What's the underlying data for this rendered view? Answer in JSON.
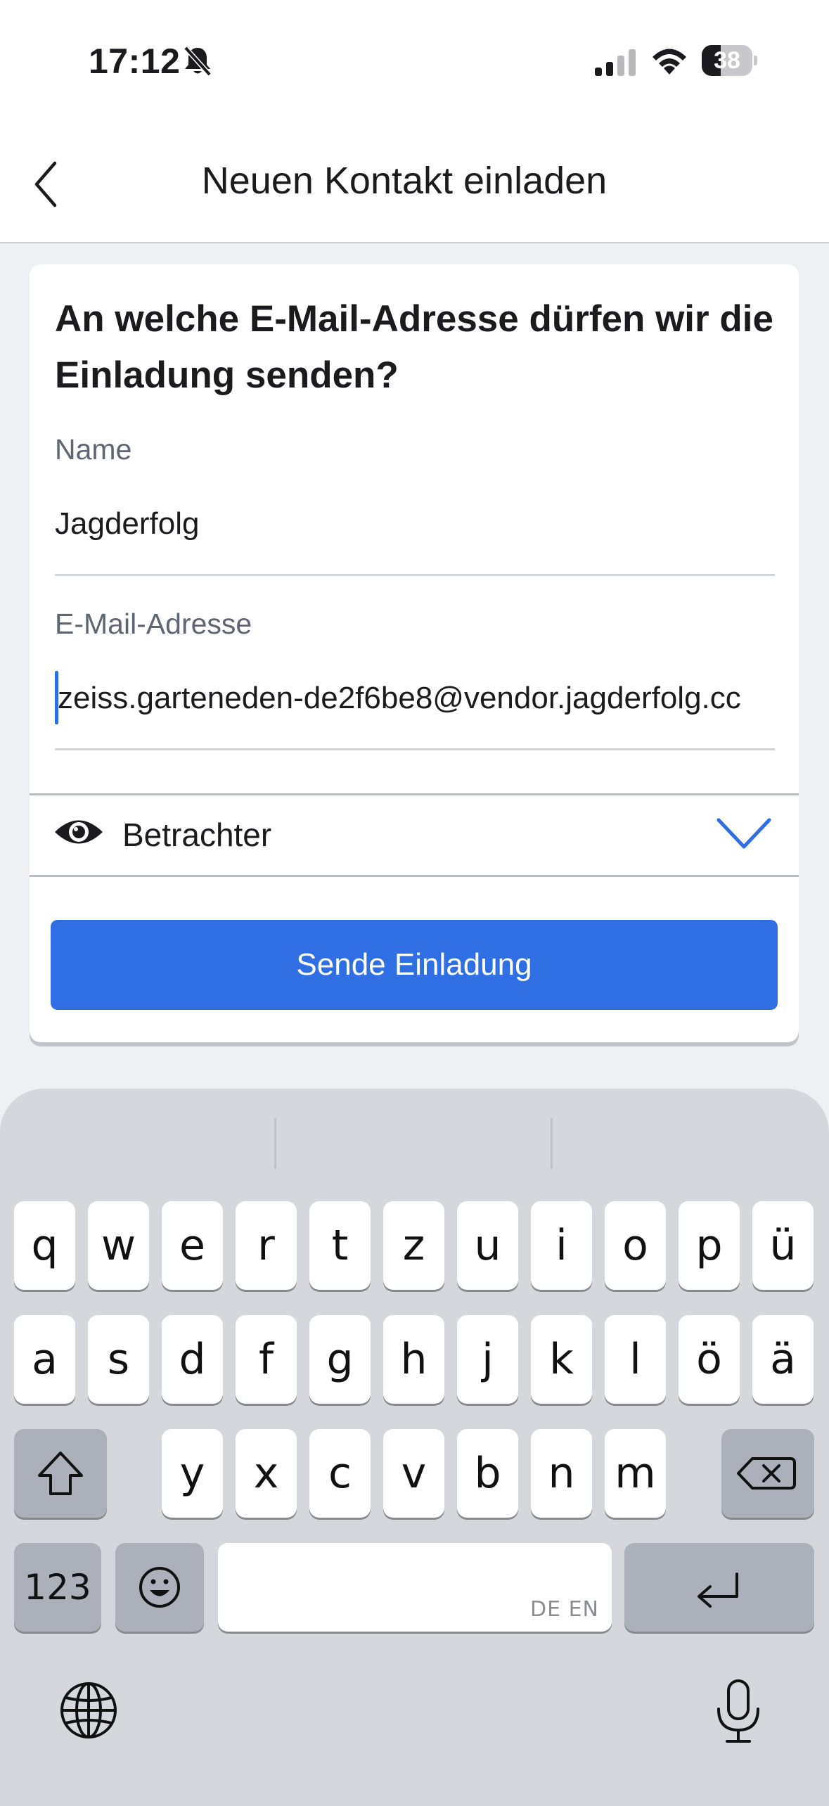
{
  "status_bar": {
    "time": "17:12",
    "battery_level": "38",
    "icons": [
      "bell-slash-icon",
      "cellular-signal-icon",
      "wifi-icon",
      "battery-icon"
    ]
  },
  "header": {
    "title": "Neuen Kontakt einladen",
    "back_icon": "chevron-left-icon"
  },
  "form": {
    "question": "An welche E-Mail-Adresse dürfen wir die Einladung senden?",
    "name_label": "Name",
    "name_value": "Jagderfolg",
    "email_label": "E-Mail-Adresse",
    "email_value": "zeiss.garteneden-de2f6be8@vendor.jagderfolg.cc",
    "role_label": "Betrachter",
    "role_icon": "eye-icon",
    "role_dropdown_icon": "chevron-down-icon",
    "submit_label": "Sende Einladung"
  },
  "keyboard": {
    "row1": [
      "q",
      "w",
      "e",
      "r",
      "t",
      "z",
      "u",
      "i",
      "o",
      "p",
      "ü"
    ],
    "row2": [
      "a",
      "s",
      "d",
      "f",
      "g",
      "h",
      "j",
      "k",
      "l",
      "ö",
      "ä"
    ],
    "row3": [
      "y",
      "x",
      "c",
      "v",
      "b",
      "n",
      "m"
    ],
    "numbers_label": "123",
    "space_languages": "DE EN",
    "icons": [
      "shift-icon",
      "backspace-icon",
      "emoji-icon",
      "return-icon",
      "globe-icon",
      "microphone-icon"
    ]
  },
  "colors": {
    "accent": "#2f6fe3",
    "background": "#eef0f4",
    "keyboard_bg": "#d5d7dc"
  }
}
